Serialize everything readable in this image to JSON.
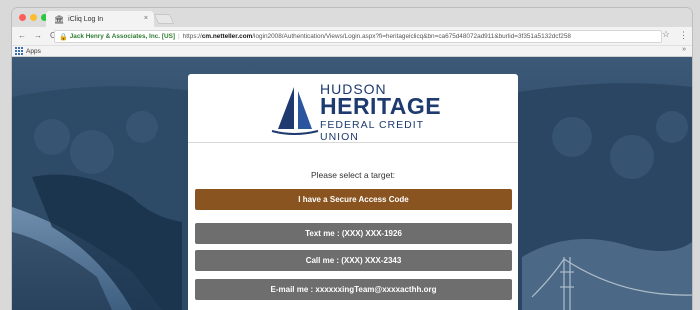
{
  "browser": {
    "tab_title": "iCliq Log In",
    "tab_close": "×",
    "nav": {
      "back": "←",
      "forward": "→",
      "reload": "C"
    },
    "secure_label": "Jack Henry & Associates, Inc. [US]",
    "url_scheme": "https://",
    "url_domain": "cm.netteller.com",
    "url_path": "/login2008/Authentication/Views/Login.aspx?fi=heritageiclicq&bn=ca675d48072ad911&burlid=3f351a5132dcf258",
    "bookmarks_label": "Apps",
    "more_label": "»",
    "colors": {
      "close": "#fc5f57",
      "minimize": "#fdbd2e",
      "maximize": "#28c840"
    }
  },
  "login": {
    "logo": {
      "line1": "HUDSON",
      "line2": "HERITAGE",
      "line3": "FEDERAL CREDIT UNION",
      "brand_color": "#1e3a6e"
    },
    "prompt": "Please select a target:",
    "buttons": [
      {
        "label": "I have a Secure Access Code",
        "style": "primary"
      },
      {
        "label": "Text me : (XXX) XXX-1926",
        "style": "gray"
      },
      {
        "label": "Call me : (XXX) XXX-2343",
        "style": "gray"
      },
      {
        "label": "E-mail me : xxxxxxingTeam@xxxxacthh.org",
        "style": "gray"
      }
    ]
  }
}
